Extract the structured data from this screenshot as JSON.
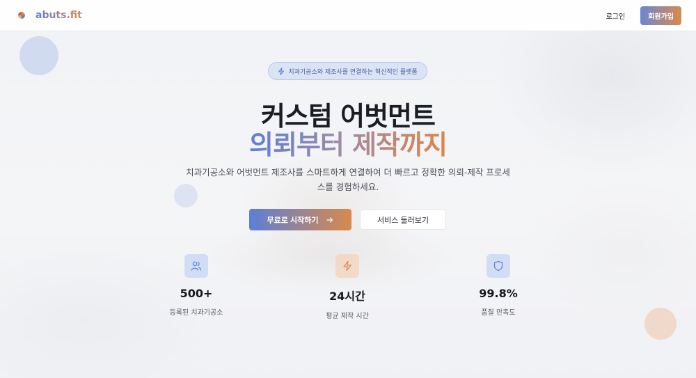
{
  "header": {
    "brand": "abuts.fit",
    "login_label": "로그인",
    "signup_label": "회원가입"
  },
  "hero": {
    "badge": "치과기공소와 제조사를 연결하는 혁신적인 플랫폼",
    "title_line1": "커스텀 어벗먼트",
    "title_line2": "의뢰부터 제작까지",
    "description": "치과기공소와 어벗먼트 제조사를 스마트하게 연결하여 더 빠르고 정확한 의뢰-제작 프로세스를 경험하세요.",
    "primary_cta": "무료로 시작하기",
    "secondary_cta": "서비스 둘러보기"
  },
  "stats": [
    {
      "icon": "users-icon",
      "value": "500+",
      "label": "등록된 치과기공소"
    },
    {
      "icon": "lightning-icon",
      "value": "24시간",
      "label": "평균 제작 시간"
    },
    {
      "icon": "shield-icon",
      "value": "99.8%",
      "label": "품질 만족도"
    }
  ],
  "colors": {
    "brand_blue": "#5b7fd6",
    "brand_orange": "#d88a4c"
  }
}
